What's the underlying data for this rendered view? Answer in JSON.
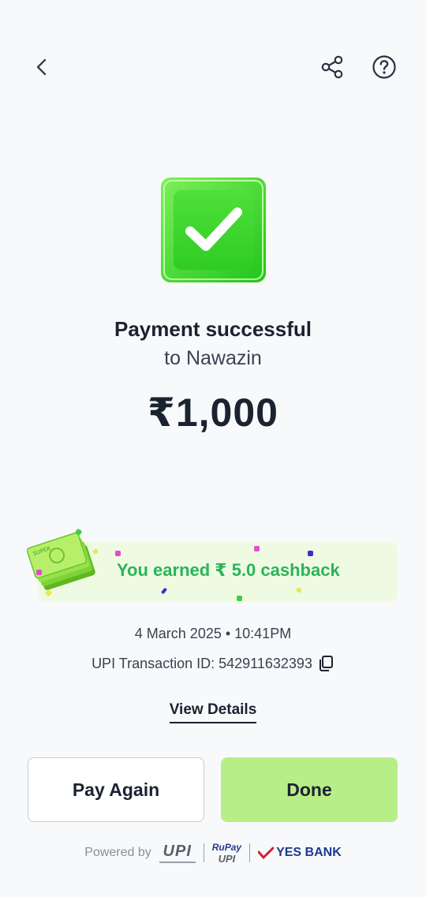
{
  "header": {
    "back_icon": "chevron-left-icon",
    "share_icon": "share-icon",
    "help_icon": "help-circle-icon"
  },
  "status": {
    "icon": "check-square-icon",
    "title": "Payment successful",
    "recipient": "to Nawazin",
    "amount": "₹1,000"
  },
  "cashback": {
    "text": "You earned ₹ 5.0 cashback",
    "illustration": "cash-stack-icon",
    "stack_label": "SUPER"
  },
  "details": {
    "datetime": "4 March 2025 • 10:41PM",
    "txn_id": "UPI Transaction ID: 542911632393",
    "copy_icon": "copy-icon",
    "view_details": "View Details"
  },
  "actions": {
    "pay_again": "Pay Again",
    "done": "Done"
  },
  "footer": {
    "powered_by": "Powered by",
    "upi_logo": "UPI",
    "rupay_logo": "RuPay",
    "rupay_sub": "UPI",
    "bank": "YES BANK"
  },
  "colors": {
    "accent_green": "#2bb35a",
    "done_button": "#b8ee88",
    "background": "#f7f9fb",
    "bank_red": "#d0202e",
    "bank_blue": "#1b3a8c"
  }
}
